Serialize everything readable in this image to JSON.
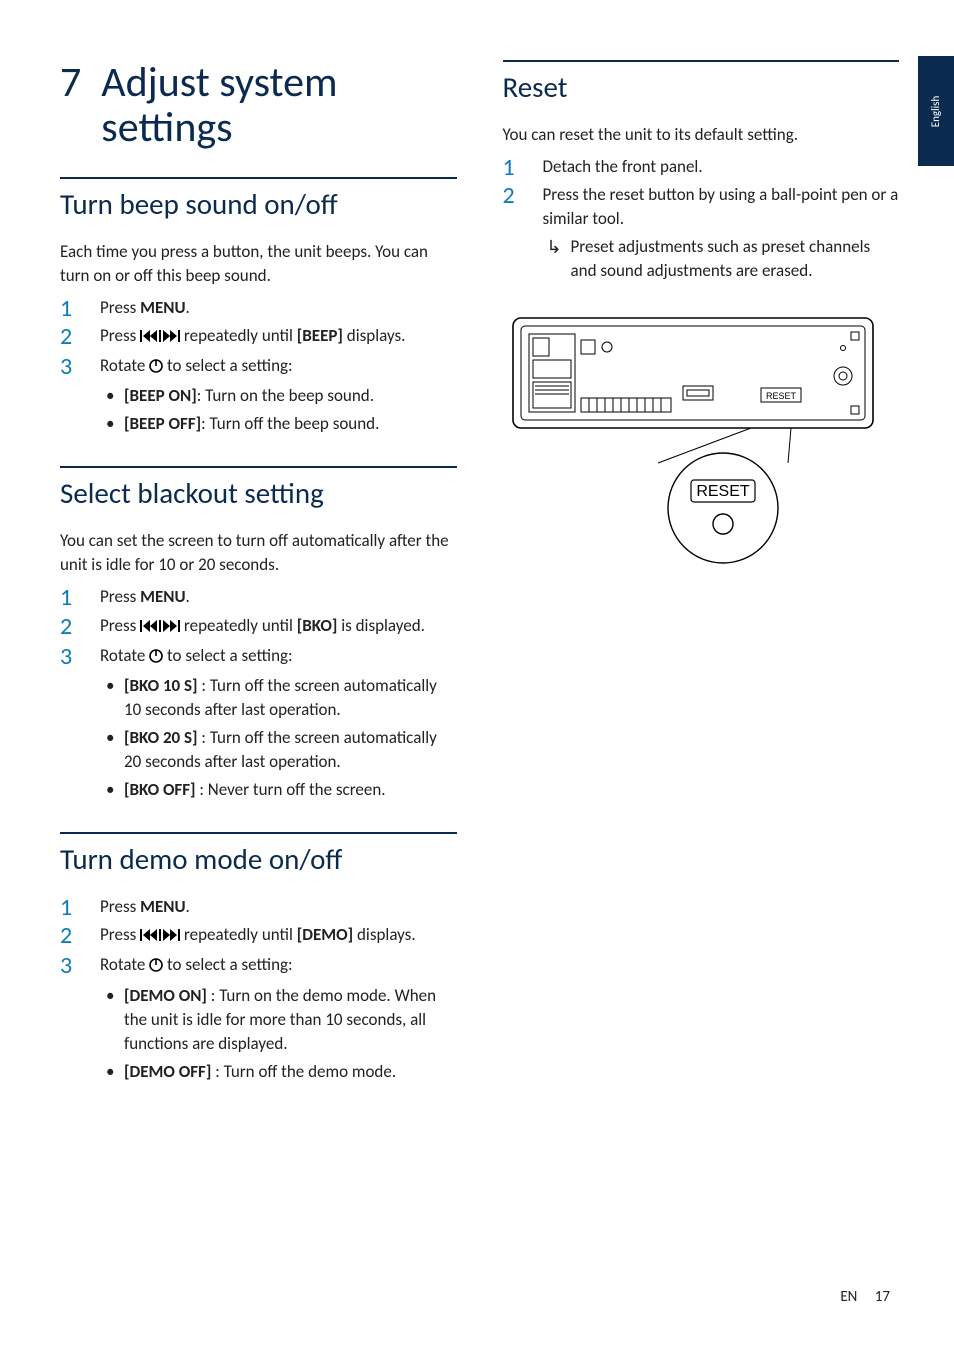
{
  "sideTab": "English",
  "chapter": {
    "number": "7",
    "title": "Adjust system settings"
  },
  "sections": {
    "beep": {
      "heading": "Turn beep sound on/off",
      "intro": "Each time you press a button, the unit beeps. You can turn on or off this beep sound.",
      "step1_pre": "Press ",
      "step1_bold": "MENU",
      "step1_post": ".",
      "step2_pre": "Press ",
      "step2_mid": " repeatedly until ",
      "step2_bold": "[BEEP]",
      "step2_post": " displays.",
      "step3_pre": "Rotate ",
      "step3_post": " to select a setting:",
      "opt1_bold": "[BEEP ON]",
      "opt1_text": ": Turn on the beep sound.",
      "opt2_bold": "[BEEP OFF]",
      "opt2_text": ": Turn off the beep sound."
    },
    "blackout": {
      "heading": "Select blackout setting",
      "intro": "You can set the screen to turn off automatically after the unit is idle for 10 or 20 seconds.",
      "step1_pre": "Press ",
      "step1_bold": "MENU",
      "step1_post": ".",
      "step2_pre": "Press ",
      "step2_mid": " repeatedly until ",
      "step2_bold": "[BKO]",
      "step2_post": " is displayed.",
      "step3_pre": "Rotate ",
      "step3_post": " to select a setting:",
      "opt1_bold": "[BKO 10 S]",
      "opt1_text": " : Turn off the screen automatically 10 seconds after last operation.",
      "opt2_bold": "[BKO 20 S]",
      "opt2_text": " : Turn off the screen automatically 20 seconds after last operation.",
      "opt3_bold": "[BKO OFF]",
      "opt3_text": " : Never turn off the screen."
    },
    "demo": {
      "heading": "Turn demo mode on/off",
      "step1_pre": "Press ",
      "step1_bold": "MENU",
      "step1_post": ".",
      "step2_pre": "Press ",
      "step2_mid": " repeatedly until ",
      "step2_bold": "[DEMO]",
      "step2_post": " displays.",
      "step3_pre": "Rotate ",
      "step3_post": " to select a setting:",
      "opt1_bold": "[DEMO ON]",
      "opt1_text": " : Turn on the demo mode. When the unit is idle for more than 10 seconds, all functions are displayed.",
      "opt2_bold": "[DEMO OFF]",
      "opt2_text": " : Turn off the demo mode."
    },
    "reset": {
      "heading": "Reset",
      "intro": "You can reset the unit to its default setting.",
      "step1": "Detach the front panel.",
      "step2": "Press the reset button by using a ball-point pen or a similar tool.",
      "result": "Preset adjustments such as preset channels and sound adjustments are erased.",
      "diagram_label": "RESET"
    }
  },
  "footer": {
    "lang": "EN",
    "page": "17"
  },
  "icons": {
    "skip": "skip-prev-next-icons",
    "rotary": "rotary-knob-icon"
  }
}
